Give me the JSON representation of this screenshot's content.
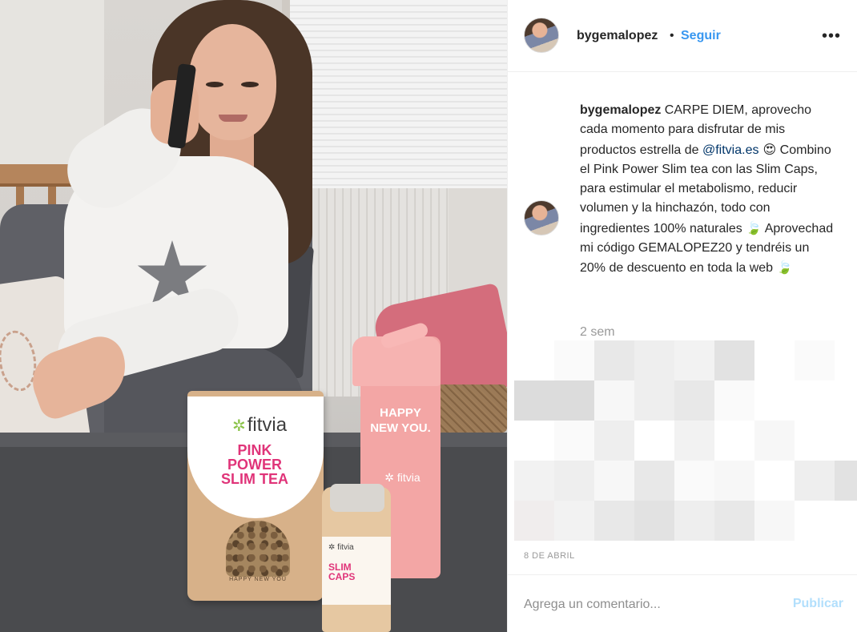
{
  "post": {
    "username": "bygemalopez",
    "separator": "•",
    "follow_label": "Seguir",
    "more_icon": "more-horizontal-icon"
  },
  "caption": {
    "username": "bygemalopez",
    "text_1": " CARPE DIEM, aprovecho cada momento para disfrutar de mis productos estrella de ",
    "mention": "@fitvia.es",
    "emoji_1": " 😍",
    "text_2": " Combino el Pink Power Slim tea con las Slim Caps, para estimular el metabolismo, reducir volumen y la hinchazón, todo con ingredientes 100% naturales ",
    "emoji_2": "🍃",
    "text_3": " Aprovechad mi código GEMALOPEZ20 y tendréis un 20% de descuento en toda la web ",
    "emoji_3": "🍃",
    "time_ago": "2 sem"
  },
  "date": "8 DE ABRIL",
  "comment": {
    "placeholder": "Agrega un comentario...",
    "publish_label": "Publicar"
  },
  "photo": {
    "tea_brand": "fitvia",
    "tea_title": "PINK POWER SLIM TEA",
    "tea_footer": "HAPPY NEW YOU",
    "shaker_text": "HAPPY NEW YOU.",
    "shaker_brand": "fitvia",
    "caps_brand": "fitvia",
    "caps_title": "SLIM CAPS"
  },
  "colors": {
    "link_blue": "#3897f0",
    "publish_disabled": "#b2dffc",
    "mention": "#003569",
    "brand_pink": "#e03479"
  }
}
